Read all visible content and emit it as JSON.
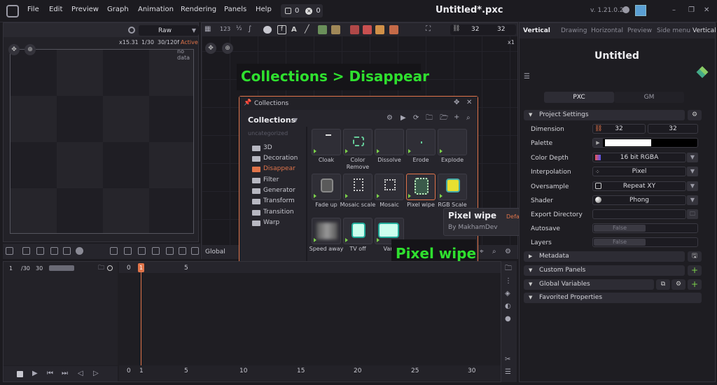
{
  "menu": [
    "File",
    "Edit",
    "Preview",
    "Graph",
    "Animation",
    "Rendering",
    "Panels",
    "Help"
  ],
  "counters": {
    "warnings": "0",
    "errors": "0"
  },
  "title": "Untitled*.pxc",
  "version": "v. 1.21.0.2",
  "preview_panel": {
    "mode": "Raw",
    "zoom": "x15.31",
    "frame": "1/30",
    "frames": "30/120f",
    "active": "Active",
    "no_data": "no data"
  },
  "graph_panel": {
    "width": "32",
    "height": "32",
    "scale": "x1",
    "bottom_label": "Global"
  },
  "overlay_top": "Collections > Disappear",
  "overlay_bottom": "Pixel wipe",
  "collections": {
    "window_title": "Collections",
    "header": "Collections",
    "uncategorized": "uncategorized",
    "folders": [
      "3D",
      "Decoration",
      "Disappear",
      "Filter",
      "Generator",
      "Transform",
      "Transition",
      "Warp"
    ],
    "selected_folder": "Disappear",
    "items": [
      "Cloak",
      "Color Remove",
      "Dissolve",
      "Erode",
      "Explode",
      "Fade up",
      "Mosaic scale",
      "Mosaic",
      "Pixel wipe",
      "RGB Scale",
      "Speed away",
      "TV off",
      "Vani"
    ]
  },
  "tooltip": {
    "title": "Pixel wipe",
    "badge": "Default",
    "author": "By MakhamDev"
  },
  "inspector": {
    "tabs": [
      "Vertical",
      "Drawing",
      "Horizontal",
      "Preview",
      "Side menu",
      "Vertical"
    ],
    "project_title": "Untitled",
    "subtabs": [
      "PXC",
      "GM"
    ],
    "project_settings": "Project Settings",
    "settings": [
      {
        "label": "Dimension",
        "x": "32",
        "y": "32"
      },
      {
        "label": "Palette"
      },
      {
        "label": "Color Depth",
        "value": "16 bit RGBA"
      },
      {
        "label": "Interpolation",
        "value": "Pixel"
      },
      {
        "label": "Oversample",
        "value": "Repeat XY"
      },
      {
        "label": "Shader",
        "value": "Phong"
      },
      {
        "label": "Export Directory",
        "value": ""
      },
      {
        "label": "Autosave",
        "value": "False"
      },
      {
        "label": "Layers",
        "value": "False"
      }
    ],
    "sections": [
      "Metadata",
      "Custom Panels",
      "Global Variables",
      "Favorited Properties"
    ]
  },
  "timeline": {
    "frame": "1",
    "total": "/30",
    "fps": "30",
    "ruler_top": [
      "0",
      "1",
      "5"
    ],
    "ruler_bottom": [
      "0",
      "1",
      "5",
      "10",
      "15",
      "20",
      "25",
      "30"
    ]
  },
  "colors": {
    "accent": "#e0744a",
    "green": "#2fe02f",
    "folder": "#b8b8c2"
  }
}
